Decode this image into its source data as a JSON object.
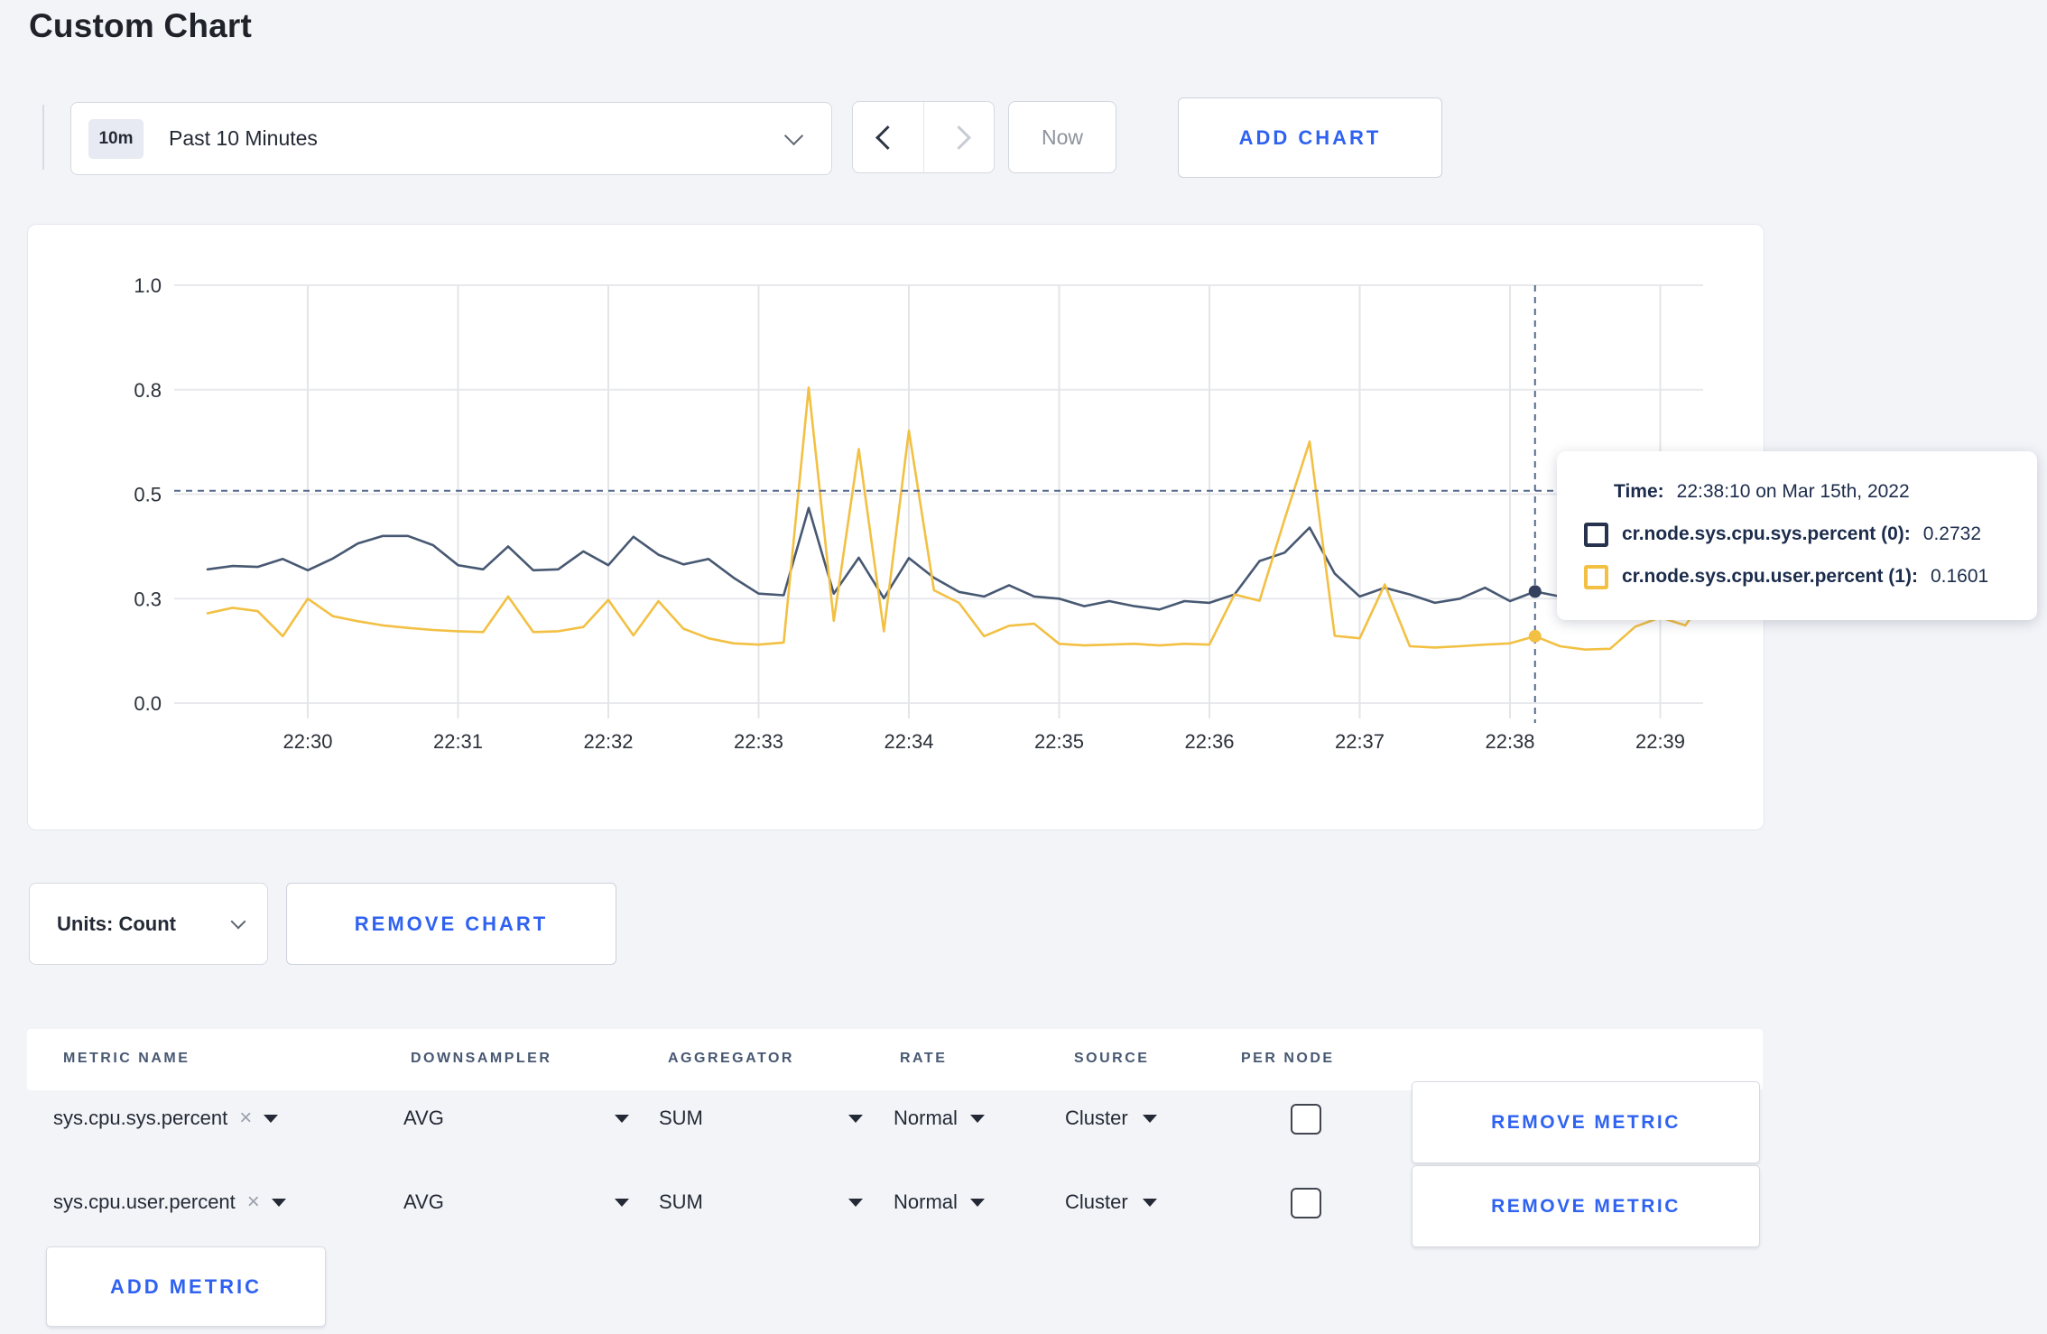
{
  "page": {
    "title": "Custom Chart"
  },
  "toolbar": {
    "time_badge": "10m",
    "time_label": "Past 10 Minutes",
    "now_label": "Now",
    "add_chart_label": "ADD CHART"
  },
  "chart_data": {
    "type": "line",
    "title": "",
    "xlabel": "",
    "ylabel": "",
    "ylim": [
      0,
      1
    ],
    "grid": true,
    "x_unit": "seconds relative to 22:30:00",
    "yticks": [
      {
        "v": 0.0,
        "label": "0.0"
      },
      {
        "v": 0.25,
        "label": "0.3"
      },
      {
        "v": 0.5,
        "label": "0.5"
      },
      {
        "v": 0.75,
        "label": "0.8"
      },
      {
        "v": 1.0,
        "label": "1.0"
      }
    ],
    "xticks": [
      {
        "t": 0,
        "label": "22:30"
      },
      {
        "t": 60,
        "label": "22:31"
      },
      {
        "t": 120,
        "label": "22:32"
      },
      {
        "t": 180,
        "label": "22:33"
      },
      {
        "t": 240,
        "label": "22:34"
      },
      {
        "t": 300,
        "label": "22:35"
      },
      {
        "t": 360,
        "label": "22:36"
      },
      {
        "t": 420,
        "label": "22:37"
      },
      {
        "t": 480,
        "label": "22:38"
      },
      {
        "t": 540,
        "label": "22:39"
      }
    ],
    "times": [
      -40,
      -30,
      -20,
      -10,
      0,
      10,
      20,
      30,
      40,
      50,
      60,
      70,
      80,
      90,
      100,
      110,
      120,
      130,
      140,
      150,
      160,
      170,
      180,
      190,
      200,
      210,
      220,
      230,
      240,
      250,
      260,
      270,
      280,
      290,
      300,
      310,
      320,
      330,
      340,
      350,
      360,
      370,
      380,
      390,
      400,
      410,
      420,
      430,
      440,
      450,
      460,
      470,
      480,
      490,
      500,
      510,
      520,
      530,
      540,
      550,
      560
    ],
    "series": [
      {
        "name": "cr.node.sys.cpu.sys.percent",
        "color": "#475872",
        "values": [
          0.32,
          0.328,
          0.326,
          0.345,
          0.318,
          0.346,
          0.382,
          0.4,
          0.4,
          0.378,
          0.33,
          0.32,
          0.375,
          0.318,
          0.32,
          0.363,
          0.33,
          0.398,
          0.355,
          0.332,
          0.345,
          0.3,
          0.262,
          0.258,
          0.467,
          0.262,
          0.348,
          0.251,
          0.347,
          0.3,
          0.266,
          0.255,
          0.282,
          0.255,
          0.25,
          0.232,
          0.244,
          0.232,
          0.224,
          0.244,
          0.24,
          0.26,
          0.34,
          0.36,
          0.42,
          0.31,
          0.255,
          0.276,
          0.26,
          0.24,
          0.25,
          0.276,
          0.244,
          0.267,
          0.255,
          0.252,
          0.26,
          0.272,
          0.268,
          0.272,
          0.275
        ]
      },
      {
        "name": "cr.node.sys.cpu.user.percent",
        "color": "#f2c043",
        "values": [
          0.215,
          0.228,
          0.22,
          0.16,
          0.25,
          0.208,
          0.196,
          0.186,
          0.18,
          0.175,
          0.172,
          0.17,
          0.255,
          0.17,
          0.172,
          0.182,
          0.247,
          0.162,
          0.244,
          0.178,
          0.155,
          0.143,
          0.14,
          0.145,
          0.755,
          0.197,
          0.608,
          0.172,
          0.652,
          0.27,
          0.24,
          0.16,
          0.185,
          0.19,
          0.142,
          0.138,
          0.14,
          0.142,
          0.138,
          0.142,
          0.14,
          0.26,
          0.245,
          0.44,
          0.626,
          0.161,
          0.155,
          0.284,
          0.136,
          0.133,
          0.136,
          0.14,
          0.143,
          0.16,
          0.136,
          0.128,
          0.13,
          0.183,
          0.205,
          0.186,
          0.268
        ]
      }
    ],
    "crosshair": {
      "t": 490,
      "hline_v": 0.508,
      "dot_values": [
        0.267,
        0.16
      ]
    }
  },
  "tooltip": {
    "time_label": "Time:",
    "time_value": "22:38:10 on Mar 15th, 2022",
    "rows": [
      {
        "name": "cr.node.sys.cpu.sys.percent (0):",
        "value": "0.2732",
        "color": "#26324e"
      },
      {
        "name": "cr.node.sys.cpu.user.percent (1):",
        "value": "0.1601",
        "color": "#f2c043"
      }
    ]
  },
  "units_row": {
    "units_label": "Units: Count",
    "remove_chart_label": "REMOVE CHART"
  },
  "table": {
    "headers": [
      "METRIC NAME",
      "DOWNSAMPLER",
      "AGGREGATOR",
      "RATE",
      "SOURCE",
      "PER NODE"
    ],
    "rows": [
      {
        "metric": "sys.cpu.sys.percent",
        "downsampler": "AVG",
        "aggregator": "SUM",
        "rate": "Normal",
        "source": "Cluster",
        "per_node": false
      },
      {
        "metric": "sys.cpu.user.percent",
        "downsampler": "AVG",
        "aggregator": "SUM",
        "rate": "Normal",
        "source": "Cluster",
        "per_node": false
      }
    ],
    "remove_metric_label": "REMOVE METRIC",
    "add_metric_label": "ADD METRIC"
  }
}
